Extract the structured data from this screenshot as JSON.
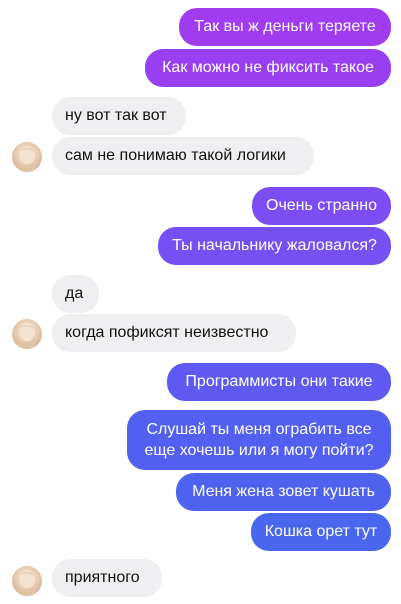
{
  "colors": {
    "outgoing_top": "#9b3ef0",
    "outgoing_mid": "#7a4ff3",
    "outgoing_bottom": "#4a63ee",
    "incoming_bg": "#efeff1"
  },
  "messages": [
    {
      "dir": "out",
      "text": "Так вы ж деньги теряете"
    },
    {
      "dir": "out",
      "text": "Как можно не фиксить такое"
    },
    {
      "dir": "in",
      "text": "ну вот так вот"
    },
    {
      "dir": "in",
      "text": "сам не понимаю такой логики"
    },
    {
      "dir": "out",
      "text": "Очень странно"
    },
    {
      "dir": "out",
      "text": "Ты начальнику жаловался?"
    },
    {
      "dir": "in",
      "text": "да"
    },
    {
      "dir": "in",
      "text": "когда пофиксят неизвестно"
    },
    {
      "dir": "out",
      "text": "Программисты они такие"
    },
    {
      "dir": "out",
      "line1": "Слушай ты меня ограбить все",
      "line2": "еще хочешь или я могу пойти?"
    },
    {
      "dir": "out",
      "text": "Меня жена зовет кушать"
    },
    {
      "dir": "out",
      "text": "Кошка орет тут"
    },
    {
      "dir": "in",
      "text": "приятного"
    }
  ]
}
